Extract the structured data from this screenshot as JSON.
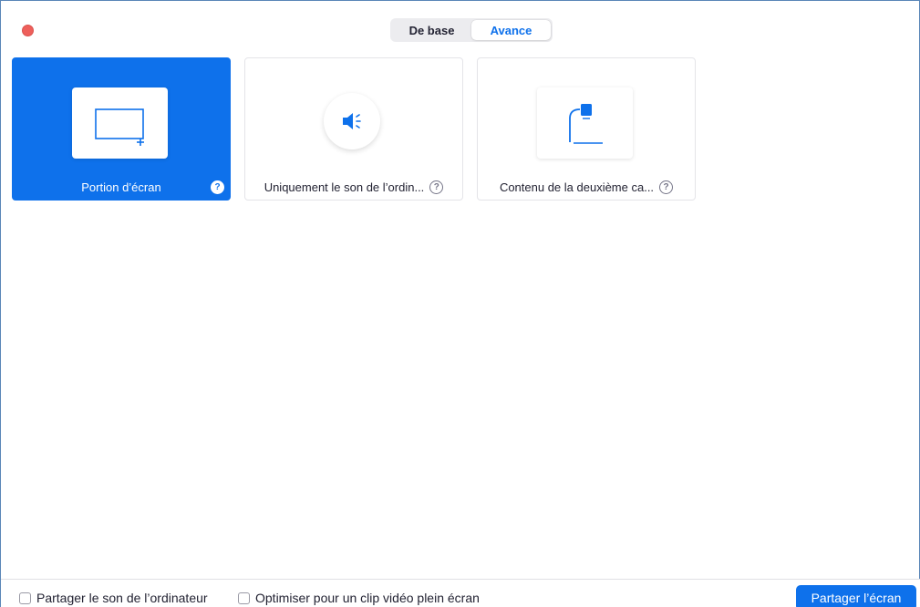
{
  "tabs": {
    "basic_label": "De base",
    "advanced_label": "Avance",
    "active": "advanced"
  },
  "cards": [
    {
      "label": "Portion d’écran",
      "selected": true,
      "icon": "screen-portion-icon"
    },
    {
      "label": "Uniquement le son de l’ordin...",
      "selected": false,
      "icon": "speaker-icon"
    },
    {
      "label": "Contenu de la deuxième ca...",
      "selected": false,
      "icon": "document-camera-icon"
    }
  ],
  "help_glyph": "?",
  "footer": {
    "share_sound_label": "Partager le son de l’ordinateur",
    "share_sound_checked": false,
    "optimize_video_label": "Optimiser pour un clip vidéo plein écran",
    "optimize_video_checked": false,
    "share_button_label": "Partager l’écran"
  },
  "colors": {
    "accent": "#0e71eb",
    "close_dot": "#ee5f5b"
  }
}
